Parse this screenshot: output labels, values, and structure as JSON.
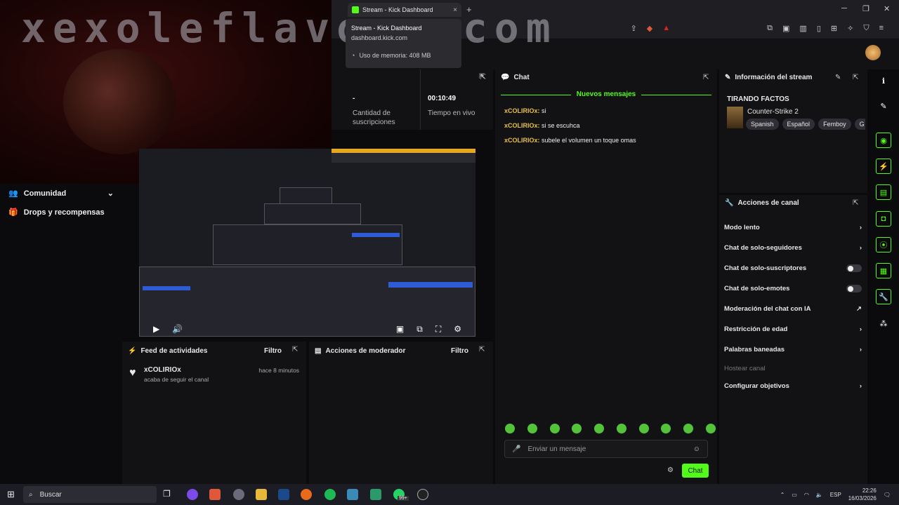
{
  "watermark": "xexoleflavour.com",
  "browser": {
    "tab_title": "Stream - Kick Dashboard",
    "tab_close": "×",
    "new_tab": "+",
    "tooltip": {
      "title": "Stream - Kick Dashboard",
      "url": "dashboard.kick.com",
      "memory": "Uso de memoria: 408 MB"
    },
    "window_controls": [
      "─",
      "❐",
      "✕"
    ],
    "toolbar_icons": [
      "share-icon",
      "brave-shield-icon",
      "rewards-icon",
      "extensions-icon",
      "screenshot-icon",
      "sidebar-icon",
      "bookmarks-icon",
      "split-view-icon",
      "leo-icon",
      "vpn-icon",
      "menu-icon"
    ]
  },
  "sidebar": {
    "items": [
      {
        "label": "Comunidad",
        "icon": "users-icon",
        "expandable": true
      },
      {
        "label": "Drops y recompensas",
        "icon": "gift-icon",
        "expandable": false
      }
    ]
  },
  "stats": {
    "subs_value": "-",
    "subs_label": "Cantidad de suscripciones",
    "live_value": "00:10:49",
    "live_label": "Tiempo en vivo"
  },
  "preview": {
    "controls": [
      "play-icon",
      "volume-icon",
      "pip-icon",
      "clip-icon",
      "fullscreen-icon",
      "settings-icon"
    ]
  },
  "activity_feed": {
    "title": "Feed de actividades",
    "filter": "Filtro",
    "events": [
      {
        "user": "xCOLIRIOx",
        "action": "acaba de seguir el canal",
        "time": "hace 8 minutos"
      }
    ]
  },
  "mod_actions": {
    "title": "Acciones de moderador",
    "filter": "Filtro"
  },
  "chat": {
    "title": "Chat",
    "new_messages": "Nuevos mensajes",
    "messages": [
      {
        "user": "xCOLIRIOx:",
        "text": "si"
      },
      {
        "user": "xCOLIRIOx:",
        "text": "si se escuhca"
      },
      {
        "user": "xCOLIRIOx:",
        "text": "subele el volumen un toque omas"
      }
    ],
    "input_placeholder": "Enviar un mensaje",
    "send_label": "Chat",
    "emote_count": 10
  },
  "stream_info": {
    "title": "Información del stream",
    "stream_title": "TIRANDO FACTOS",
    "category": "Counter-Strike 2",
    "tags": [
      "Spanish",
      "Español",
      "Femboy",
      "G"
    ]
  },
  "channel_actions": {
    "title": "Acciones de canal",
    "rows": [
      {
        "label": "Modo lento",
        "control": "arrow"
      },
      {
        "label": "Chat de solo-seguidores",
        "control": "arrow"
      },
      {
        "label": "Chat de solo-suscriptores",
        "control": "toggle"
      },
      {
        "label": "Chat de solo-emotes",
        "control": "toggle"
      },
      {
        "label": "Moderación del chat con IA",
        "control": "link"
      },
      {
        "label": "Restricción de edad",
        "control": "arrow"
      },
      {
        "label": "Palabras baneadas",
        "control": "arrow"
      },
      {
        "label": "Hostear canal",
        "control": "disabled"
      },
      {
        "label": "Configurar objetivos",
        "control": "arrow"
      }
    ]
  },
  "rail": [
    "info-icon",
    "pencil-icon",
    "camera-icon",
    "bolt-icon",
    "document-icon",
    "chat-icon",
    "broadcast-icon",
    "layout-icon",
    "wrench-icon",
    "apps-icon"
  ],
  "taskbar": {
    "search_placeholder": "Buscar",
    "badge": "99+",
    "language": "ESP",
    "time": "22:26",
    "date": "16/03/2026"
  },
  "colors": {
    "accent": "#53fc18",
    "panel": "#121214",
    "username": "#e8c04a"
  }
}
